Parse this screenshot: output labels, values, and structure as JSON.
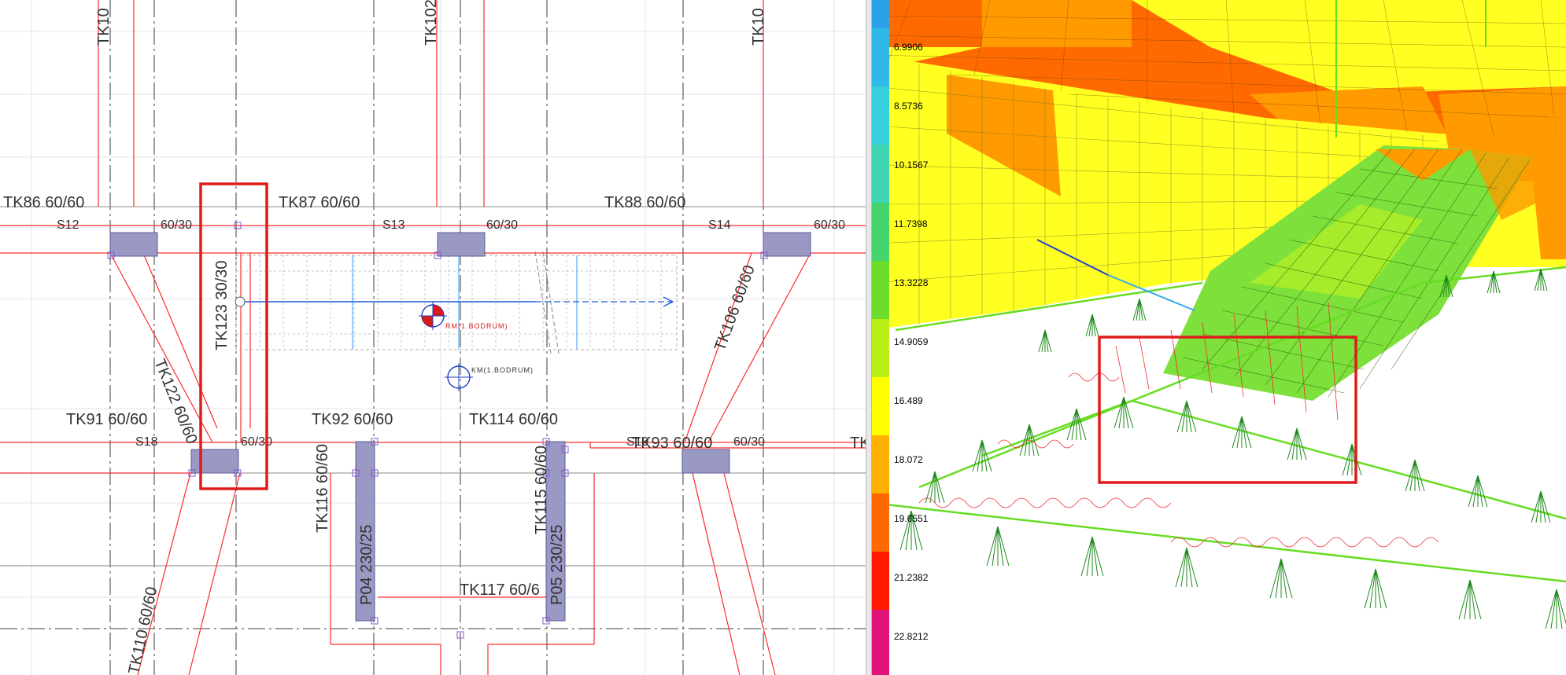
{
  "plan": {
    "beams": [
      {
        "id": "tk86",
        "label": "TK86 60/60"
      },
      {
        "id": "tk87",
        "label": "TK87 60/60"
      },
      {
        "id": "tk88",
        "label": "TK88 60/60"
      },
      {
        "id": "tk91",
        "label": "TK91 60/60"
      },
      {
        "id": "tk92",
        "label": "TK92 60/60"
      },
      {
        "id": "tk114",
        "label": "TK114 60/60"
      },
      {
        "id": "tk93",
        "label": "TK93 60/60"
      },
      {
        "id": "tk117",
        "label": "TK117 60/6"
      },
      {
        "id": "tk101",
        "label": "TK10"
      },
      {
        "id": "tk102",
        "label": "TK102"
      },
      {
        "id": "tk103",
        "label": "TK10"
      },
      {
        "id": "tk123",
        "label": "TK123 30/30"
      },
      {
        "id": "tk122",
        "label": "TK122 60/60"
      },
      {
        "id": "tk106",
        "label": "TK106 60/60"
      },
      {
        "id": "tk116",
        "label": "TK116 60/60"
      },
      {
        "id": "tk115",
        "label": "TK115 60/60"
      },
      {
        "id": "tk110",
        "label": "TK110 60/60"
      },
      {
        "id": "tk-edge",
        "label": "TK"
      }
    ],
    "columns": [
      {
        "id": "s12",
        "label": "S12",
        "size": "60/30"
      },
      {
        "id": "s13",
        "label": "S13",
        "size": "60/30"
      },
      {
        "id": "s14",
        "label": "S14",
        "size": "60/30"
      },
      {
        "id": "s18",
        "label": "S18",
        "size": "60/30"
      },
      {
        "id": "s19",
        "label": "S19",
        "size": "60/30"
      }
    ],
    "walls": [
      {
        "id": "p04",
        "label": "P04 230/25"
      },
      {
        "id": "p05",
        "label": "P05 230/25"
      }
    ],
    "markers": {
      "rm": "RM(1.BODRUM)",
      "km": "KM(1.BODRUM)"
    },
    "colors": {
      "beam_line": "#ff2a2a",
      "axis_line": "#3c3c3c",
      "column_fill": "#9999c4",
      "highlight": "#e01b1b",
      "stair_line": "#1f5fd6"
    }
  },
  "analysis": {
    "legend_values": [
      "6.9906",
      "8.5736",
      "10.1567",
      "11.7398",
      "13.3228",
      "14.9059",
      "16.489",
      "18.072",
      "19.6551",
      "21.2382",
      "22.8212"
    ],
    "legend_colors": [
      "#2aa0e6",
      "#2fb9e8",
      "#35d0dc",
      "#3fd6b4",
      "#46d46e",
      "#6edc2c",
      "#b8ee14",
      "#ffff00",
      "#ffb000",
      "#ff7a00",
      "#ff3a00",
      "#e0147a"
    ],
    "mesh_colors": {
      "yellow": "#ffff22",
      "orange": "#ff9a00",
      "dark_orange": "#ff6a00",
      "green": "#7ee03a",
      "support": "#1e8a1e"
    }
  }
}
